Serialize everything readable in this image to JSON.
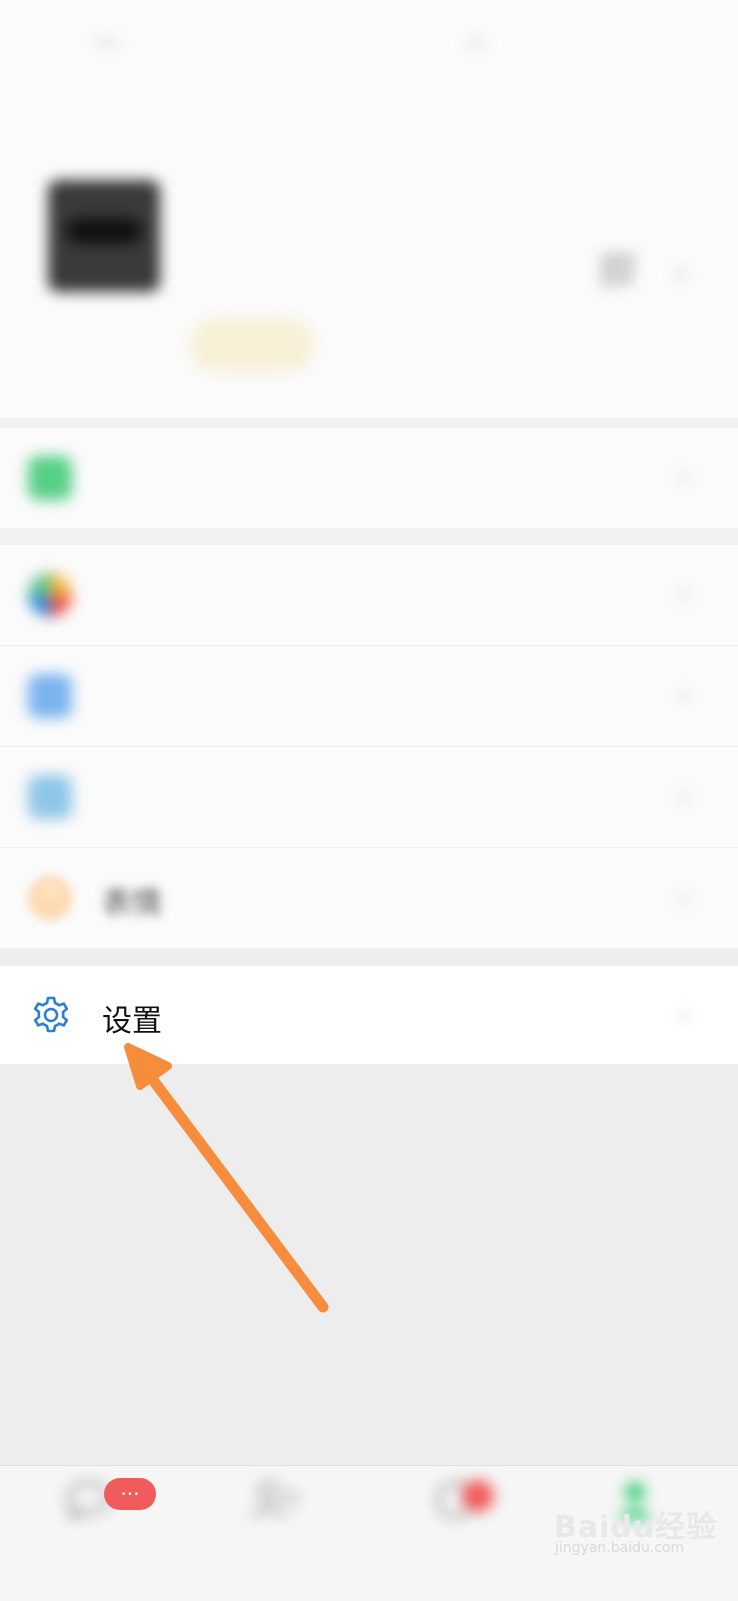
{
  "status_bar": {
    "left_text": "…",
    "right_text": "…"
  },
  "profile": {
    "nickname": "",
    "wechat_id": "",
    "status_label": ""
  },
  "menu": {
    "pay": {
      "label": "",
      "icon": "pay-icon"
    },
    "favorites": {
      "label": "",
      "icon": "favorites-icon"
    },
    "moments": {
      "label": "",
      "icon": "moments-icon"
    },
    "cards": {
      "label": "",
      "icon": "cards-icon"
    },
    "sticker": {
      "label": "表情",
      "icon": "smiley-icon"
    },
    "settings": {
      "label": "设置",
      "icon": "gear-icon"
    }
  },
  "tabbar": {
    "chats": {
      "label": "",
      "badge": "···"
    },
    "contacts": {
      "label": ""
    },
    "discover": {
      "label": ""
    },
    "me": {
      "label": ""
    }
  },
  "watermark": {
    "text": "Baidu经验",
    "sub": "jingyan.baidu.com"
  },
  "colors": {
    "accent_blue": "#2b7fd4",
    "arrow_orange": "#f58d3c",
    "badge_red": "#f25b5b",
    "wechat_green": "#3fcf7a"
  }
}
